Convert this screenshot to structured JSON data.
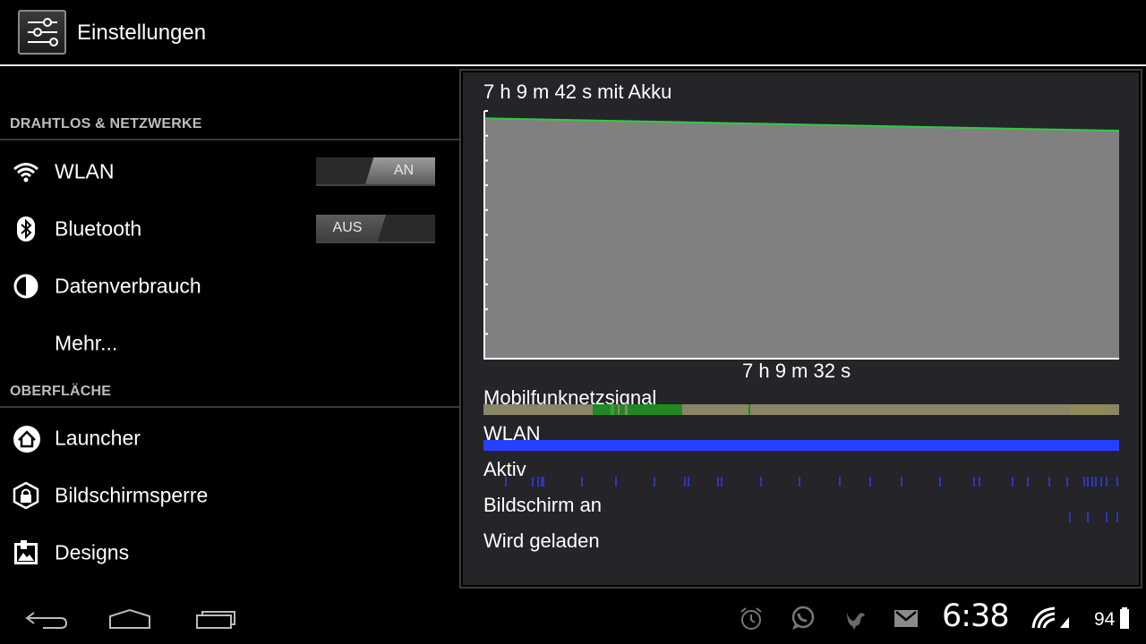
{
  "app": {
    "title": "Einstellungen",
    "icon": "settings-sliders-icon"
  },
  "sections": {
    "wireless": "DRAHTLOS & NETZWERKE",
    "ui": "OBERFLÄCHE"
  },
  "items": {
    "wlan": {
      "label": "WLAN",
      "icon": "wifi-icon",
      "toggle": "AN"
    },
    "bluetooth": {
      "label": "Bluetooth",
      "icon": "bluetooth-icon",
      "toggle": "AUS"
    },
    "data": {
      "label": "Datenverbrauch",
      "icon": "data-usage-icon"
    },
    "more": {
      "label": "Mehr..."
    },
    "launcher": {
      "label": "Launcher",
      "icon": "home-icon"
    },
    "lock": {
      "label": "Bildschirmsperre",
      "icon": "lock-icon"
    },
    "designs": {
      "label": "Designs",
      "icon": "designs-icon"
    }
  },
  "battery": {
    "title": "7 h 9 m 42 s mit Akku",
    "duration": "7 h 9 m 32 s",
    "level_start": 0.97,
    "level_end": 0.92,
    "line_color": "#2ecc40",
    "fill_color": "#808080",
    "rows": {
      "signal": "Mobilfunknetzsignal",
      "wlan": "WLAN",
      "active": "Aktiv",
      "screen": "Bildschirm an",
      "charging": "Wird geladen"
    },
    "wlan_color": "#2541ff",
    "signal_color": "#8a8564",
    "signal_good_color": "#1f8a1f"
  },
  "status": {
    "time": "6:38",
    "battery": "94",
    "icons": [
      "alarm-icon",
      "whatsapp-icon",
      "bird-icon",
      "gmail-icon",
      "wifi-signal-icon",
      "cell-signal-icon",
      "battery-icon"
    ]
  },
  "nav": [
    "back-button",
    "home-button",
    "recent-apps-button"
  ]
}
